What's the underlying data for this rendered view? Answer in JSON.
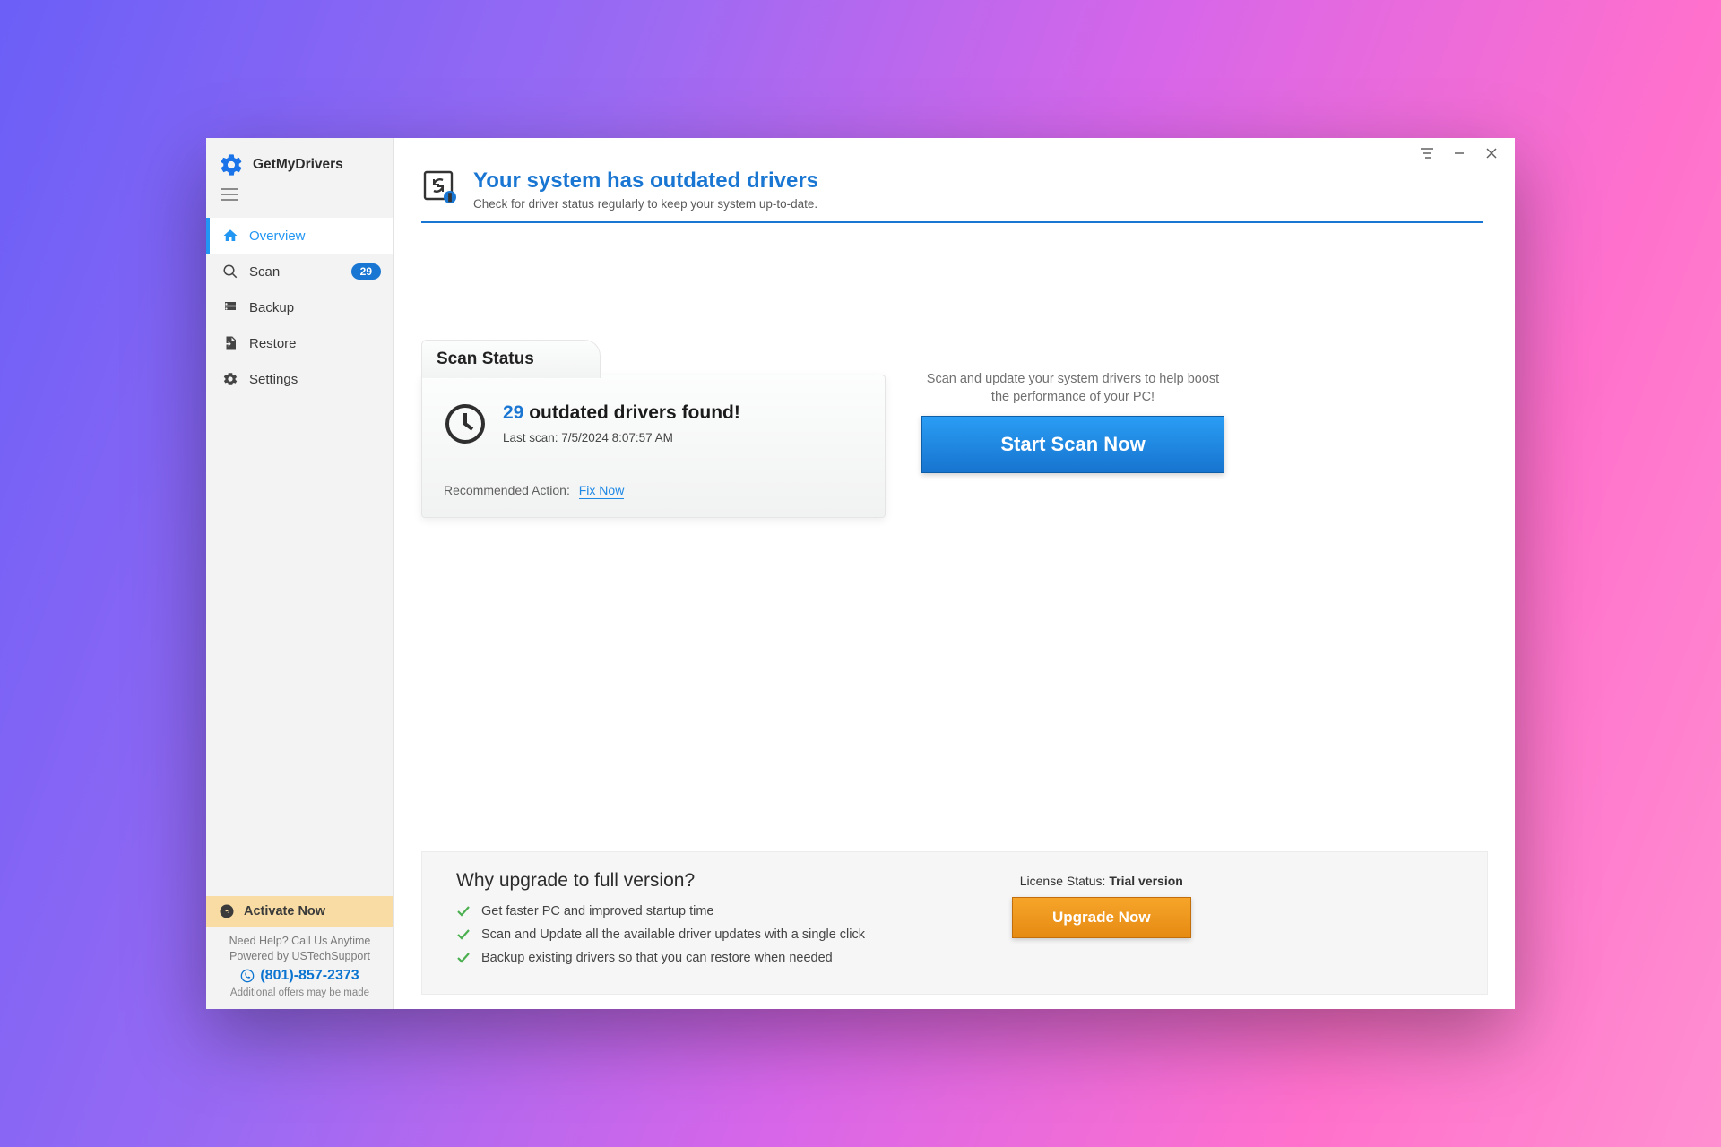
{
  "app": {
    "title": "GetMyDrivers"
  },
  "sidebar": {
    "items": [
      {
        "label": "Overview"
      },
      {
        "label": "Scan",
        "badge": "29"
      },
      {
        "label": "Backup"
      },
      {
        "label": "Restore"
      },
      {
        "label": "Settings"
      }
    ],
    "activate": "Activate Now",
    "help_line1": "Need Help? Call Us Anytime",
    "help_line2": "Powered by USTechSupport",
    "phone": "(801)-857-2373",
    "offers": "Additional offers may be made"
  },
  "header": {
    "title": "Your system has outdated drivers",
    "subtitle": "Check for driver status regularly to keep your system up-to-date."
  },
  "scan": {
    "tab": "Scan Status",
    "count": "29",
    "headline_rest": " outdated drivers found!",
    "last_scan": "Last scan: 7/5/2024 8:07:57 AM",
    "rec_label": "Recommended Action:",
    "fix_link": "Fix Now"
  },
  "cta": {
    "text": "Scan and update your system drivers to help boost the performance of your PC!",
    "button": "Start Scan Now"
  },
  "upgrade": {
    "title": "Why upgrade to full version?",
    "benefits": [
      "Get faster PC and improved startup time",
      "Scan and Update all the available driver updates with a single click",
      "Backup existing drivers so that you can restore when needed"
    ],
    "license_label": "License Status: ",
    "license_value": "Trial version",
    "button": "Upgrade Now"
  }
}
